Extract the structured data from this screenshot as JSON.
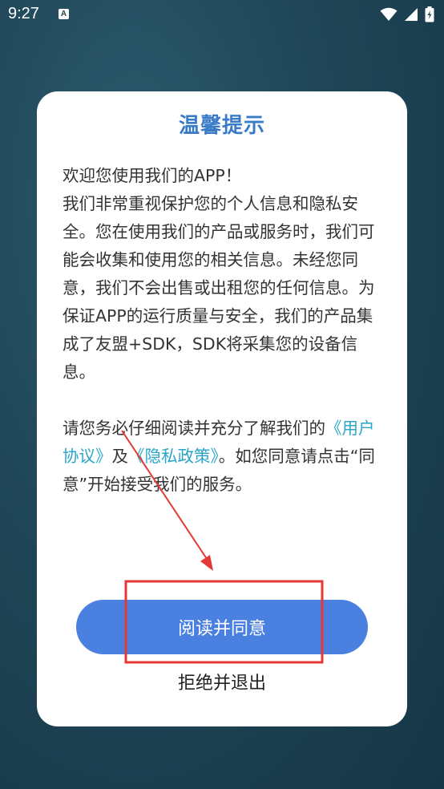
{
  "status_bar": {
    "time": "9:27",
    "icons": [
      "a-notification-icon",
      "wifi-icon",
      "cellular-signal-icon",
      "battery-charging-icon"
    ]
  },
  "dialog": {
    "title": "温馨提示",
    "paragraph1": [
      "欢迎您使用我们的APP！",
      "我们非常重视保护您的个人信息和隐私安全。您在使用我们的产品或服务时，我们可能会收集和使用您的相关信息。未经您同意，我们不会出售或出租您的任何信息。为保证APP的运行质量与安全，我们的产品集成了友盟+SDK，SDK将采集您的设备信息。"
    ],
    "paragraph2": {
      "prefix": "请您务必仔细阅读并充分了解我们的",
      "user_agreement_link": "《用户协议》",
      "conjunction": "及",
      "privacy_policy_link": "《隐私政策》",
      "suffix": "。如您同意请点击“同意”开始接受我们的服务。"
    },
    "agree_button_label": "阅读并同意",
    "exit_button_label": "拒绝并退出"
  },
  "colors": {
    "title": "#3a7bc8",
    "link": "#2aa6c9",
    "agree_button": "#4a80e0",
    "annotation": "#e53935"
  }
}
